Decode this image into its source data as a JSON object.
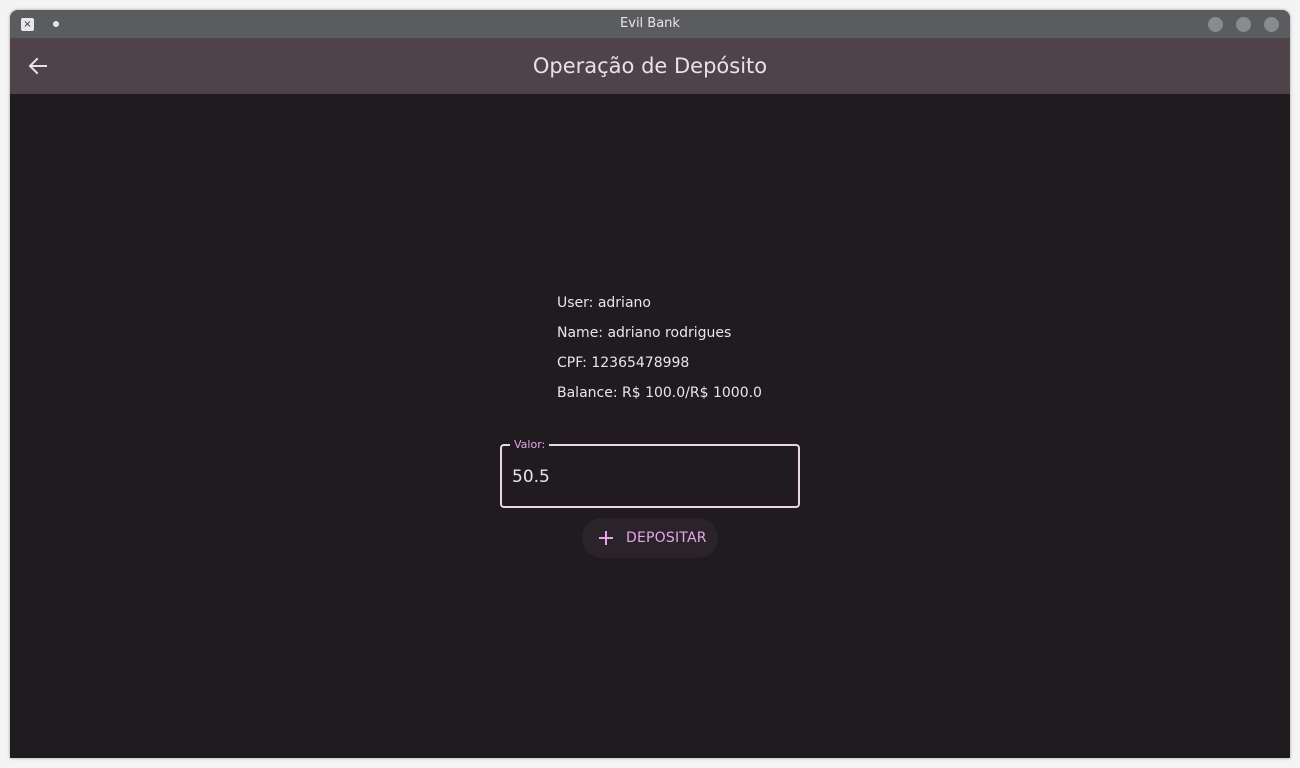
{
  "window": {
    "title": "Evil Bank",
    "app_icon": "close-box-icon"
  },
  "appbar": {
    "title": "Operação de Depósito",
    "back_icon": "arrow-left-icon"
  },
  "account": {
    "user": "User: adriano",
    "name": "Name: adriano rodrigues",
    "cpf": "CPF: 12365478998",
    "balance": "Balance: R$ 100.0/R$ 1000.0"
  },
  "form": {
    "amount_label": "Valor:",
    "amount_value": "50.5",
    "deposit_label": "DEPOSITAR",
    "deposit_icon": "plus-icon"
  },
  "colors": {
    "accent": "#e6a6e6",
    "appbar": "#4f4349",
    "background": "#1f1b1f",
    "titlebar": "#5b5c60"
  }
}
